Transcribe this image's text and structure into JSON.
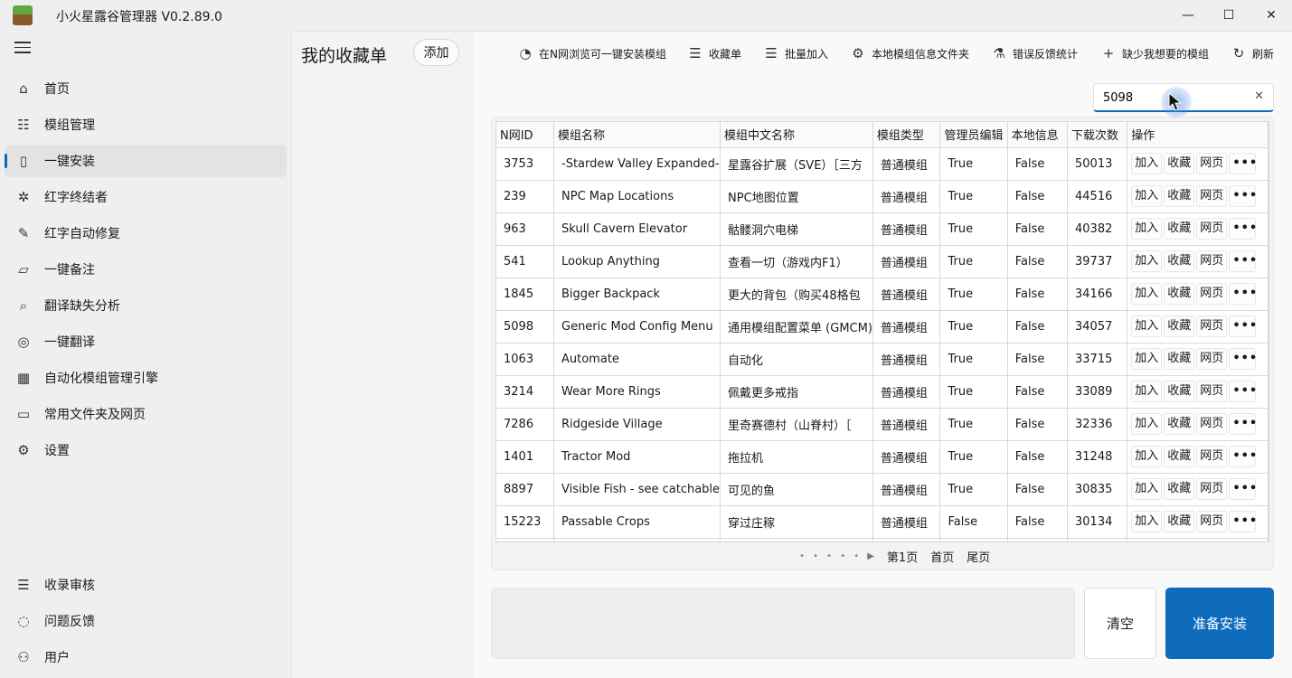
{
  "window": {
    "title": "小火星露谷管理器 V0.2.89.0",
    "minimize": "—",
    "maximize": "☐",
    "close": "✕"
  },
  "sidebar": {
    "items": [
      {
        "label": "首页",
        "icon": "home-icon",
        "glyph": "⌂"
      },
      {
        "label": "模组管理",
        "icon": "list-icon",
        "glyph": "☷"
      },
      {
        "label": "一键安装",
        "icon": "clipboard-icon",
        "glyph": "▯",
        "active": true
      },
      {
        "label": "红字终结者",
        "icon": "bug-icon",
        "glyph": "✲"
      },
      {
        "label": "红字自动修复",
        "icon": "wrench-icon",
        "glyph": "✎"
      },
      {
        "label": "一键备注",
        "icon": "note-icon",
        "glyph": "▱"
      },
      {
        "label": "翻译缺失分析",
        "icon": "search-icon",
        "glyph": "⌕"
      },
      {
        "label": "一键翻译",
        "icon": "globe-icon",
        "glyph": "◎"
      },
      {
        "label": "自动化模组管理引擎",
        "icon": "calculator-icon",
        "glyph": "▦"
      },
      {
        "label": "常用文件夹及网页",
        "icon": "folder-icon",
        "glyph": "▭"
      },
      {
        "label": "设置",
        "icon": "gear-icon",
        "glyph": "⚙"
      }
    ],
    "bottom_items": [
      {
        "label": "收录审核",
        "icon": "menu-icon",
        "glyph": "☰"
      },
      {
        "label": "问题反馈",
        "icon": "chat-icon",
        "glyph": "◌"
      },
      {
        "label": "用户",
        "icon": "user-icon",
        "glyph": "⚇"
      }
    ]
  },
  "favorites": {
    "title": "我的收藏单",
    "add_label": "添加"
  },
  "toolbar": {
    "buttons": [
      {
        "label": "在N网浏览可一键安装模组",
        "icon": "compass-icon",
        "glyph": "◔"
      },
      {
        "label": "收藏单",
        "icon": "bullet-list-icon",
        "glyph": "☰"
      },
      {
        "label": "批量加入",
        "icon": "batch-add-icon",
        "glyph": "☰"
      },
      {
        "label": "本地模组信息文件夹",
        "icon": "folder-settings-icon",
        "glyph": "⚙"
      },
      {
        "label": "错误反馈统计",
        "icon": "flask-icon",
        "glyph": "⚗"
      },
      {
        "label": "缺少我想要的模组",
        "icon": "plus-icon",
        "glyph": "+"
      },
      {
        "label": "刷新",
        "icon": "refresh-icon",
        "glyph": "↻"
      }
    ]
  },
  "search": {
    "value": "5098",
    "clear": "✕"
  },
  "table": {
    "columns": [
      "N网ID",
      "模组名称",
      "模组中文名称",
      "模组类型",
      "管理员编辑",
      "本地信息",
      "下载次数",
      "操作"
    ],
    "ops": {
      "add": "加入",
      "fav": "收藏",
      "web": "网页",
      "more": "•••"
    },
    "rows": [
      {
        "id": "3753",
        "name": "-Stardew Valley Expanded-",
        "cn": "星露谷扩展（SVE）［三方",
        "type": "普通模组",
        "admin": "True",
        "local": "False",
        "downloads": "50013"
      },
      {
        "id": "239",
        "name": "NPC Map Locations",
        "cn": "NPC地图位置",
        "type": "普通模组",
        "admin": "True",
        "local": "False",
        "downloads": "44516"
      },
      {
        "id": "963",
        "name": "Skull Cavern Elevator",
        "cn": "骷髅洞穴电梯",
        "type": "普通模组",
        "admin": "True",
        "local": "False",
        "downloads": "40382"
      },
      {
        "id": "541",
        "name": "Lookup Anything",
        "cn": "查看一切（游戏内F1）",
        "type": "普通模组",
        "admin": "True",
        "local": "False",
        "downloads": "39737"
      },
      {
        "id": "1845",
        "name": "Bigger Backpack",
        "cn": "更大的背包（购买48格包",
        "type": "普通模组",
        "admin": "True",
        "local": "False",
        "downloads": "34166"
      },
      {
        "id": "5098",
        "name": "Generic Mod Config Menu",
        "cn": "通用模组配置菜单 (GMCM)",
        "type": "普通模组",
        "admin": "True",
        "local": "False",
        "downloads": "34057"
      },
      {
        "id": "1063",
        "name": "Automate",
        "cn": "自动化",
        "type": "普通模组",
        "admin": "True",
        "local": "False",
        "downloads": "33715"
      },
      {
        "id": "3214",
        "name": "Wear More Rings",
        "cn": "佩戴更多戒指",
        "type": "普通模组",
        "admin": "True",
        "local": "False",
        "downloads": "33089"
      },
      {
        "id": "7286",
        "name": "Ridgeside Village",
        "cn": "里奇赛德村（山脊村）［",
        "type": "普通模组",
        "admin": "True",
        "local": "False",
        "downloads": "32336"
      },
      {
        "id": "1401",
        "name": "Tractor Mod",
        "cn": "拖拉机",
        "type": "普通模组",
        "admin": "True",
        "local": "False",
        "downloads": "31248"
      },
      {
        "id": "8897",
        "name": "Visible Fish - see catchable",
        "cn": "可见的鱼",
        "type": "普通模组",
        "admin": "True",
        "local": "False",
        "downloads": "30835"
      },
      {
        "id": "15223",
        "name": "Passable Crops",
        "cn": "穿过庄稼",
        "type": "普通模组",
        "admin": "False",
        "local": "False",
        "downloads": "30134"
      },
      {
        "id": "",
        "name": "",
        "cn": "",
        "type": "",
        "admin": "",
        "local": "",
        "downloads": ""
      }
    ]
  },
  "pager": {
    "dots": "• • • • •",
    "next": "▶",
    "current": "第1页",
    "first": "首页",
    "last": "尾页"
  },
  "bottom": {
    "clear_label": "清空",
    "install_label": "准备安装"
  },
  "colors": {
    "accent": "#0f6cbd"
  }
}
